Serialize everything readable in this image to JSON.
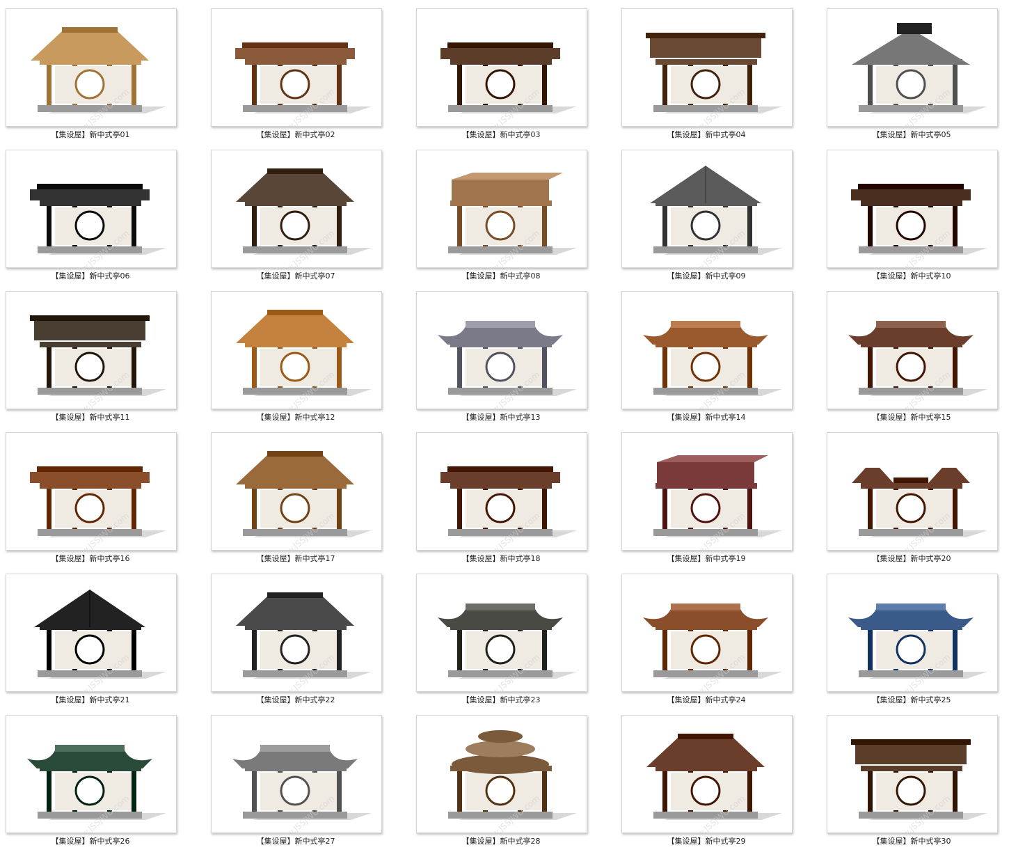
{
  "items": [
    {
      "id": "01",
      "caption": "【集设屋】新中式亭01",
      "roof": "hip",
      "color": "#c89a5e"
    },
    {
      "id": "02",
      "caption": "【集设屋】新中式亭02",
      "roof": "flat",
      "color": "#8a5a3a"
    },
    {
      "id": "03",
      "caption": "【集设屋】新中式亭03",
      "roof": "flat",
      "color": "#5c3d2a"
    },
    {
      "id": "04",
      "caption": "【集设屋】新中式亭04",
      "roof": "gate",
      "color": "#6b4a34"
    },
    {
      "id": "05",
      "caption": "【集设屋】新中式亭05",
      "roof": "gable",
      "color": "#777777"
    },
    {
      "id": "06",
      "caption": "【集设屋】新中式亭06",
      "roof": "flat",
      "color": "#333333"
    },
    {
      "id": "07",
      "caption": "【集设屋】新中式亭07",
      "roof": "hip",
      "color": "#5a4636"
    },
    {
      "id": "08",
      "caption": "【集设屋】新中式亭08",
      "roof": "box",
      "color": "#a0744c"
    },
    {
      "id": "09",
      "caption": "【集设屋】新中式亭09",
      "roof": "pyramid",
      "color": "#5a5a5a"
    },
    {
      "id": "10",
      "caption": "【集设屋】新中式亭10",
      "roof": "flat",
      "color": "#4a2e20"
    },
    {
      "id": "11",
      "caption": "【集设屋】新中式亭11",
      "roof": "gate",
      "color": "#4a3e32"
    },
    {
      "id": "12",
      "caption": "【集设屋】新中式亭12",
      "roof": "hip",
      "color": "#c4823e"
    },
    {
      "id": "13",
      "caption": "【集设屋】新中式亭13",
      "roof": "curve",
      "color": "#7a7a88"
    },
    {
      "id": "14",
      "caption": "【集设屋】新中式亭14",
      "roof": "curve",
      "color": "#9a5a2e"
    },
    {
      "id": "15",
      "caption": "【集设屋】新中式亭15",
      "roof": "curve",
      "color": "#6a3e2a"
    },
    {
      "id": "16",
      "caption": "【集设屋】新中式亭16",
      "roof": "flat",
      "color": "#8a4e2a"
    },
    {
      "id": "17",
      "caption": "【集设屋】新中式亭17",
      "roof": "hip",
      "color": "#9a6a3a"
    },
    {
      "id": "18",
      "caption": "【集设屋】新中式亭18",
      "roof": "flat",
      "color": "#6a3e2a"
    },
    {
      "id": "19",
      "caption": "【集设屋】新中式亭19",
      "roof": "box",
      "color": "#7a3a3a"
    },
    {
      "id": "20",
      "caption": "【集设屋】新中式亭20",
      "roof": "twin",
      "color": "#6a3e2a"
    },
    {
      "id": "21",
      "caption": "【集设屋】新中式亭21",
      "roof": "pyramid",
      "color": "#222222"
    },
    {
      "id": "22",
      "caption": "【集设屋】新中式亭22",
      "roof": "hip",
      "color": "#4a4a4a"
    },
    {
      "id": "23",
      "caption": "【集设屋】新中式亭23",
      "roof": "curve",
      "color": "#4a4a44"
    },
    {
      "id": "24",
      "caption": "【集设屋】新中式亭24",
      "roof": "curve",
      "color": "#8a4e2a"
    },
    {
      "id": "25",
      "caption": "【集设屋】新中式亭25",
      "roof": "curve",
      "color": "#3a5a8a"
    },
    {
      "id": "26",
      "caption": "【集设屋】新中式亭26",
      "roof": "curve",
      "color": "#2a4a3a"
    },
    {
      "id": "27",
      "caption": "【集设屋】新中式亭27",
      "roof": "curve",
      "color": "#7a7a7a"
    },
    {
      "id": "28",
      "caption": "【集设屋】新中式亭28",
      "roof": "round",
      "color": "#7a5a3a"
    },
    {
      "id": "29",
      "caption": "【集设屋】新中式亭29",
      "roof": "hip",
      "color": "#6a3e2a"
    },
    {
      "id": "30",
      "caption": "【集设屋】新中式亭30",
      "roof": "gate",
      "color": "#5a3e2a"
    }
  ]
}
